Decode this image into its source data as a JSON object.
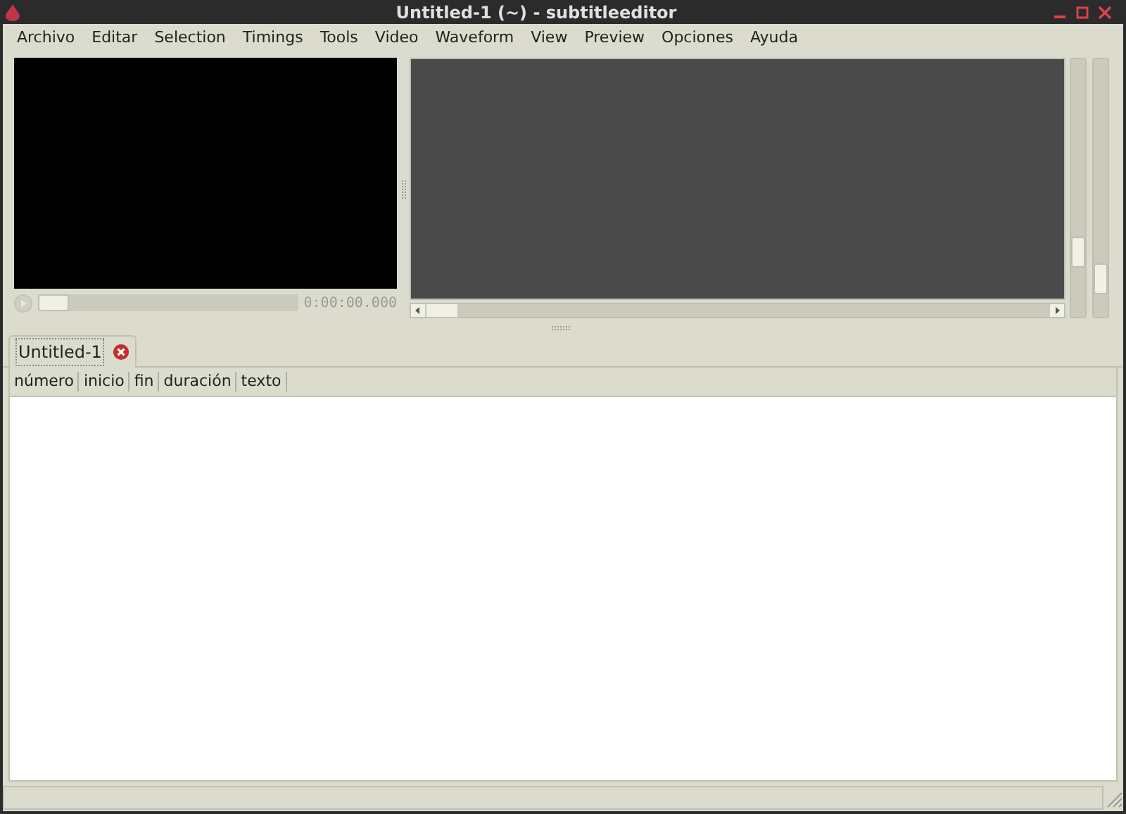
{
  "window": {
    "title": "Untitled-1 (~) - subtitleeditor"
  },
  "menu": [
    "Archivo",
    "Editar",
    "Selection",
    "Timings",
    "Tools",
    "Video",
    "Waveform",
    "View",
    "Preview",
    "Opciones",
    "Ayuda"
  ],
  "player": {
    "seek": {
      "level": 0
    },
    "time": "0:00:00.000"
  },
  "waveform": {
    "zoom_scales": [
      {
        "level": 0.22
      },
      {
        "level": 0.1
      }
    ]
  },
  "tabs": [
    {
      "label": "Untitled-1",
      "selected": true
    }
  ],
  "table": {
    "columns": [
      "número",
      "inicio",
      "fin",
      "duración",
      "texto"
    ]
  }
}
